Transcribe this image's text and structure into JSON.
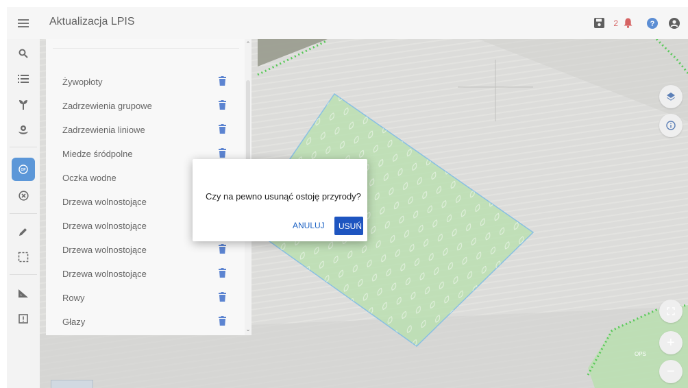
{
  "app": {
    "title": "Aktualizacja LPIS",
    "notification_count": "2"
  },
  "colors": {
    "accent": "#1e55c0",
    "active_tool": "#1e6fc9",
    "notification": "#c62828",
    "parcel_fill": "#9cd48e",
    "parcel_border": "#5aa7d8",
    "dotted_boundary": "#19b419"
  },
  "topbar": {
    "icons": [
      "save-icon",
      "bell-icon",
      "help-icon",
      "user-icon"
    ]
  },
  "sidebar": {
    "tools": [
      "search-icon",
      "list-icon",
      "plant-icon",
      "landscape-element-icon",
      "nature-refuge-icon",
      "cancel-circle-icon",
      "pencil-icon",
      "select-area-icon",
      "measure-icon",
      "report-icon"
    ],
    "active_tool": "nature-refuge-icon"
  },
  "panel": {
    "items": [
      {
        "label": "Żywopłoty"
      },
      {
        "label": "Zadrzewienia grupowe"
      },
      {
        "label": "Zadrzewienia liniowe"
      },
      {
        "label": "Miedze śródpolne"
      },
      {
        "label": "Oczka wodne"
      },
      {
        "label": "Drzewa wolnostojące"
      },
      {
        "label": "Drzewa wolnostojące"
      },
      {
        "label": "Drzewa wolnostojące"
      },
      {
        "label": "Drzewa wolnostojące"
      },
      {
        "label": "Rowy"
      },
      {
        "label": "Głazy"
      }
    ]
  },
  "map_controls": {
    "right_icons": [
      "layers-icon",
      "info-icon",
      "fullscreen-icon",
      "zoom-in-icon",
      "zoom-out-icon"
    ],
    "zoom_in_label": "+",
    "zoom_out_label": "−"
  },
  "map_labels": {
    "ops": "OPS"
  },
  "dialog": {
    "message": "Czy na pewno usunąć ostoję przyrody?",
    "cancel_label": "ANULUJ",
    "confirm_label": "USUŃ"
  }
}
